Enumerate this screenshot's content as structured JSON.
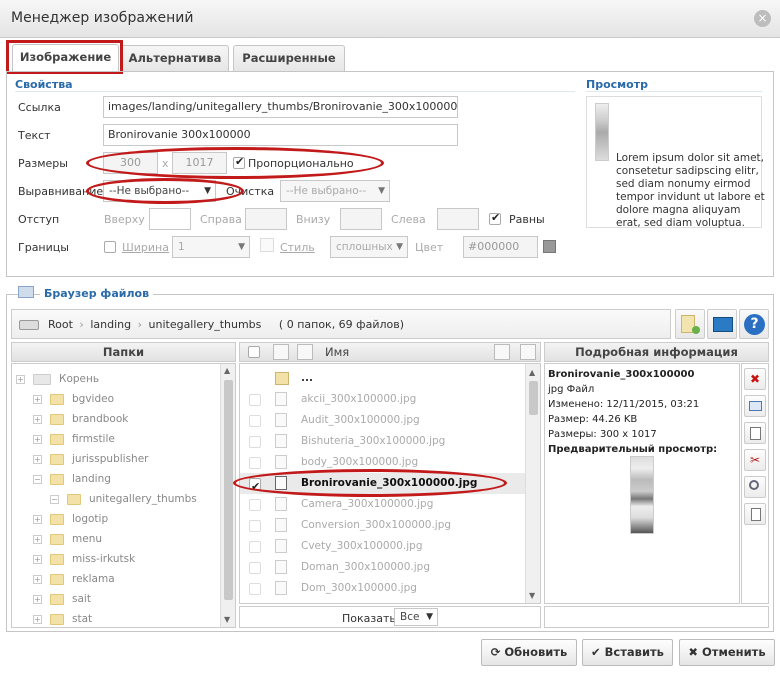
{
  "dialog": {
    "title": "Менеджер изображений",
    "close_glyph": "×"
  },
  "tabs": [
    {
      "label": "Изображение",
      "active": true
    },
    {
      "label": "Альтернатива",
      "active": false
    },
    {
      "label": "Расширенные",
      "active": false
    }
  ],
  "properties": {
    "section_title": "Свойства",
    "link_label": "Ссылка",
    "link_value": "images/landing/unitegallery_thumbs/Bronirovanie_300x100000.jpg",
    "text_label": "Текст",
    "text_value": "Bronirovanie 300x100000",
    "size_label": "Размеры",
    "width_value": "300",
    "size_sep": "x",
    "height_value": "1017",
    "proportional_label": "Пропорционально",
    "align_label": "Выравнивание",
    "align_value": "--Не выбрано--",
    "clear_label": "Очистка",
    "clear_value": "--Не выбрано--",
    "margin_label": "Отступ",
    "top_label": "Вверху",
    "right_label": "Справа",
    "bottom_label": "Внизу",
    "left_label": "Слева",
    "equal_label": "Равны",
    "border_label": "Границы",
    "width_label": "Ширина",
    "border_width_value": "1",
    "style_label": "Стиль",
    "style_value": "сплошных",
    "color_label": "Цвет",
    "color_value": "#000000"
  },
  "preview": {
    "title": "Просмотр",
    "text": "Lorem ipsum dolor sit amet, consetetur sadipscing elitr, sed diam nonumy eirmod tempor invidunt ut labore et dolore magna aliquyam erat, sed diam voluptua."
  },
  "browser": {
    "title": "Браузер файлов",
    "path": [
      "Root",
      "landing",
      "unitegallery_thumbs"
    ],
    "path_sep": "›",
    "count": "( 0 папок, 69 файлов)",
    "folders_header": "Папки",
    "name_header": "Имя",
    "details_header": "Подробная информация",
    "tree": [
      {
        "label": "Корень",
        "level": 0,
        "pm": "+",
        "root": true
      },
      {
        "label": "bgvideo",
        "level": 1,
        "pm": "+"
      },
      {
        "label": "brandbook",
        "level": 1,
        "pm": "+"
      },
      {
        "label": "firmstile",
        "level": 1,
        "pm": "+"
      },
      {
        "label": "jurisspublisher",
        "level": 1,
        "pm": "+"
      },
      {
        "label": "landing",
        "level": 1,
        "pm": "−"
      },
      {
        "label": "unitegallery_thumbs",
        "level": 2,
        "pm": "−"
      },
      {
        "label": "logotip",
        "level": 1,
        "pm": "+"
      },
      {
        "label": "menu",
        "level": 1,
        "pm": "+"
      },
      {
        "label": "miss-irkutsk",
        "level": 1,
        "pm": "+"
      },
      {
        "label": "reklama",
        "level": 1,
        "pm": "+"
      },
      {
        "label": "sait",
        "level": 1,
        "pm": "+"
      },
      {
        "label": "stat",
        "level": 1,
        "pm": "+"
      }
    ],
    "up_label": "...",
    "files": [
      "akcii_300x100000.jpg",
      "Audit_300x100000.jpg",
      "Bishuteria_300x100000.jpg",
      "body_300x100000.jpg",
      "Bronirovanie_300x100000.jpg",
      "Camera_300x100000.jpg",
      "Conversion_300x100000.jpg",
      "Cvety_300x100000.jpg",
      "Doman_300x100000.jpg",
      "Dom_300x100000.jpg"
    ],
    "selected_index": 4,
    "show_label": "Показать",
    "show_value": "Все",
    "details": {
      "name": "Bronirovanie_300x100000",
      "type": "jpg Файл",
      "modified": "Изменено: 12/11/2015, 03:21",
      "size": "Размер: 44.26 KB",
      "dimensions": "Размеры: 300 x 1017",
      "preview_label": "Предварительный просмотр:"
    }
  },
  "buttons": {
    "refresh": "Обновить",
    "insert": "Вставить",
    "cancel": "Отменить"
  },
  "colors": {
    "accent": "#2a6aa8",
    "annotation": "#c21a1a"
  }
}
